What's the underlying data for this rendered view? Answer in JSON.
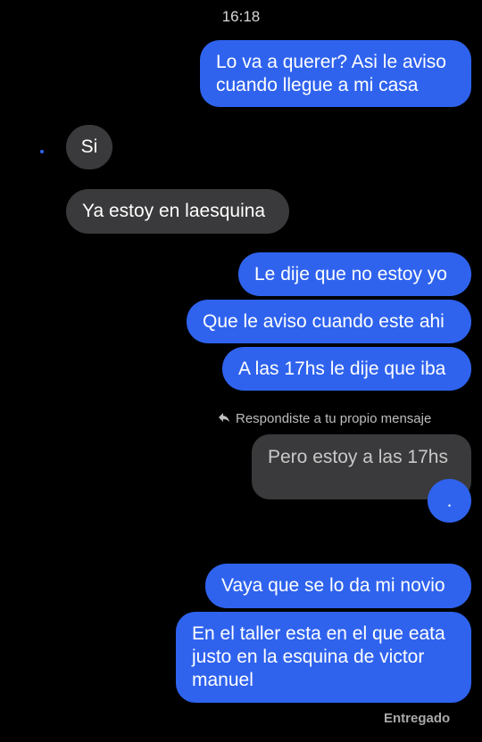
{
  "status_bar": {
    "time": "16:18"
  },
  "messages": [
    {
      "text_lines": [
        "Lo va a querer? Asi le aviso",
        "cuando llegue a mi casa"
      ],
      "from": "me"
    },
    {
      "text": "Si",
      "from": "them"
    },
    {
      "text": "Ya estoy en laesquina",
      "from": "them"
    },
    {
      "text": "Le dije que no estoy yo",
      "from": "me"
    },
    {
      "text": "Que le aviso cuando este ahi",
      "from": "me"
    },
    {
      "text": "A las 17hs le dije que iba",
      "from": "me"
    },
    {
      "text": "Pero estoy a las 17hs",
      "from": "me",
      "type": "quoted"
    },
    {
      "text": ".",
      "from": "me"
    },
    {
      "text": "Vaya que se lo da mi novio",
      "from": "me"
    },
    {
      "text_lines": [
        "En el taller esta en el que eata",
        "justo en la esquina de victor",
        "manuel"
      ],
      "from": "me"
    }
  ],
  "reply_note": "Respondiste a tu propio mensaje",
  "delivery_status": "Entregado",
  "colors": {
    "outgoing": "#2f63ee",
    "incoming": "#3a3a3c",
    "background": "#000000"
  }
}
